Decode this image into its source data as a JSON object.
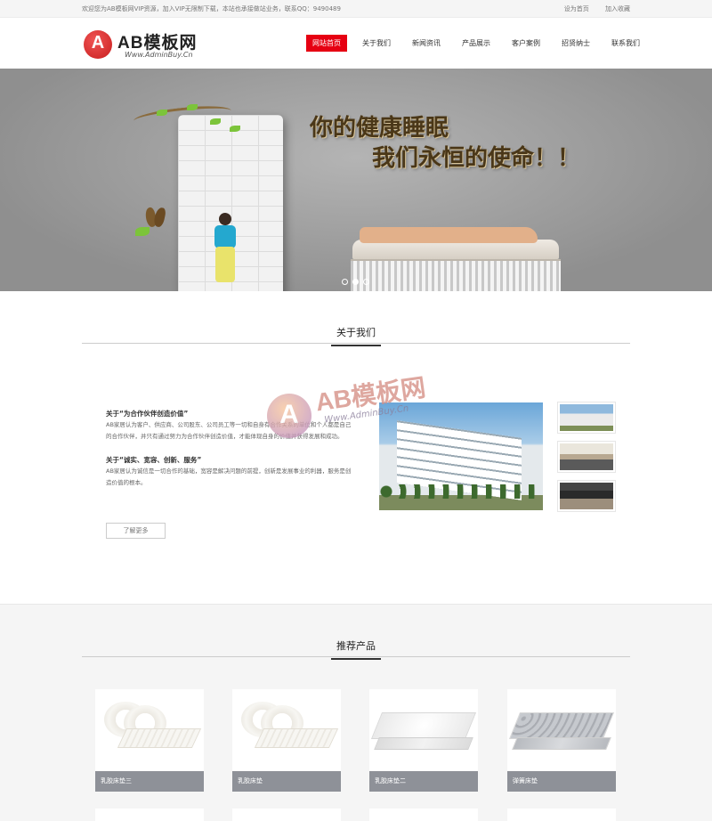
{
  "topbar": {
    "welcome": "欢迎您为AB模板网VIP资源，加入VIP无限制下载，本站也承接做站业务，联系QQ：9490489",
    "links": [
      "设为首页",
      "加入收藏"
    ]
  },
  "logo": {
    "badge": "A",
    "title": "AB模板网",
    "url": "Www.AdminBuy.Cn"
  },
  "nav": {
    "items": [
      "网站首页",
      "关于我们",
      "新闻资讯",
      "产品展示",
      "客户案例",
      "招贤纳士",
      "联系我们"
    ],
    "active_index": 0
  },
  "banner": {
    "line1": "你的健康睡眠",
    "line2": "我们永恒的使命！！",
    "slides": 3,
    "active_slide": 1
  },
  "about": {
    "heading": "关于我们",
    "q1": "关于“为合作伙伴创造价值”",
    "p1": "AB家居认为客户、供应商、公司股东、公司员工等一切和自身有合作关系的单位和个人都是自己的合作伙伴，并只有通过努力为合作伙伴创造价值，才能体现自身的价值并获得发展和成功。",
    "q2": "关于“诚实、宽容、创新、服务”",
    "p2": "AB家居认为诚信是一切合作的基础，宽容是解决问题的前提，创新是发展事业的利器，服务是创造价值的根本。",
    "more": "了解更多"
  },
  "watermark": {
    "badge": "A",
    "title": "AB模板网",
    "url": "Www.AdminBuy.Cn"
  },
  "products": {
    "heading": "推荐产品",
    "items": [
      {
        "name": "乳胶床垫三",
        "kind": "roll"
      },
      {
        "name": "乳胶床垫",
        "kind": "roll"
      },
      {
        "name": "乳胶床垫二",
        "kind": "mattress-white"
      },
      {
        "name": "弹簧床垫",
        "kind": "mattress-grey"
      }
    ]
  },
  "colors": {
    "accent": "#e60012",
    "caption_bg": "#8e9198",
    "banner_bg": "#9f9f9f"
  }
}
